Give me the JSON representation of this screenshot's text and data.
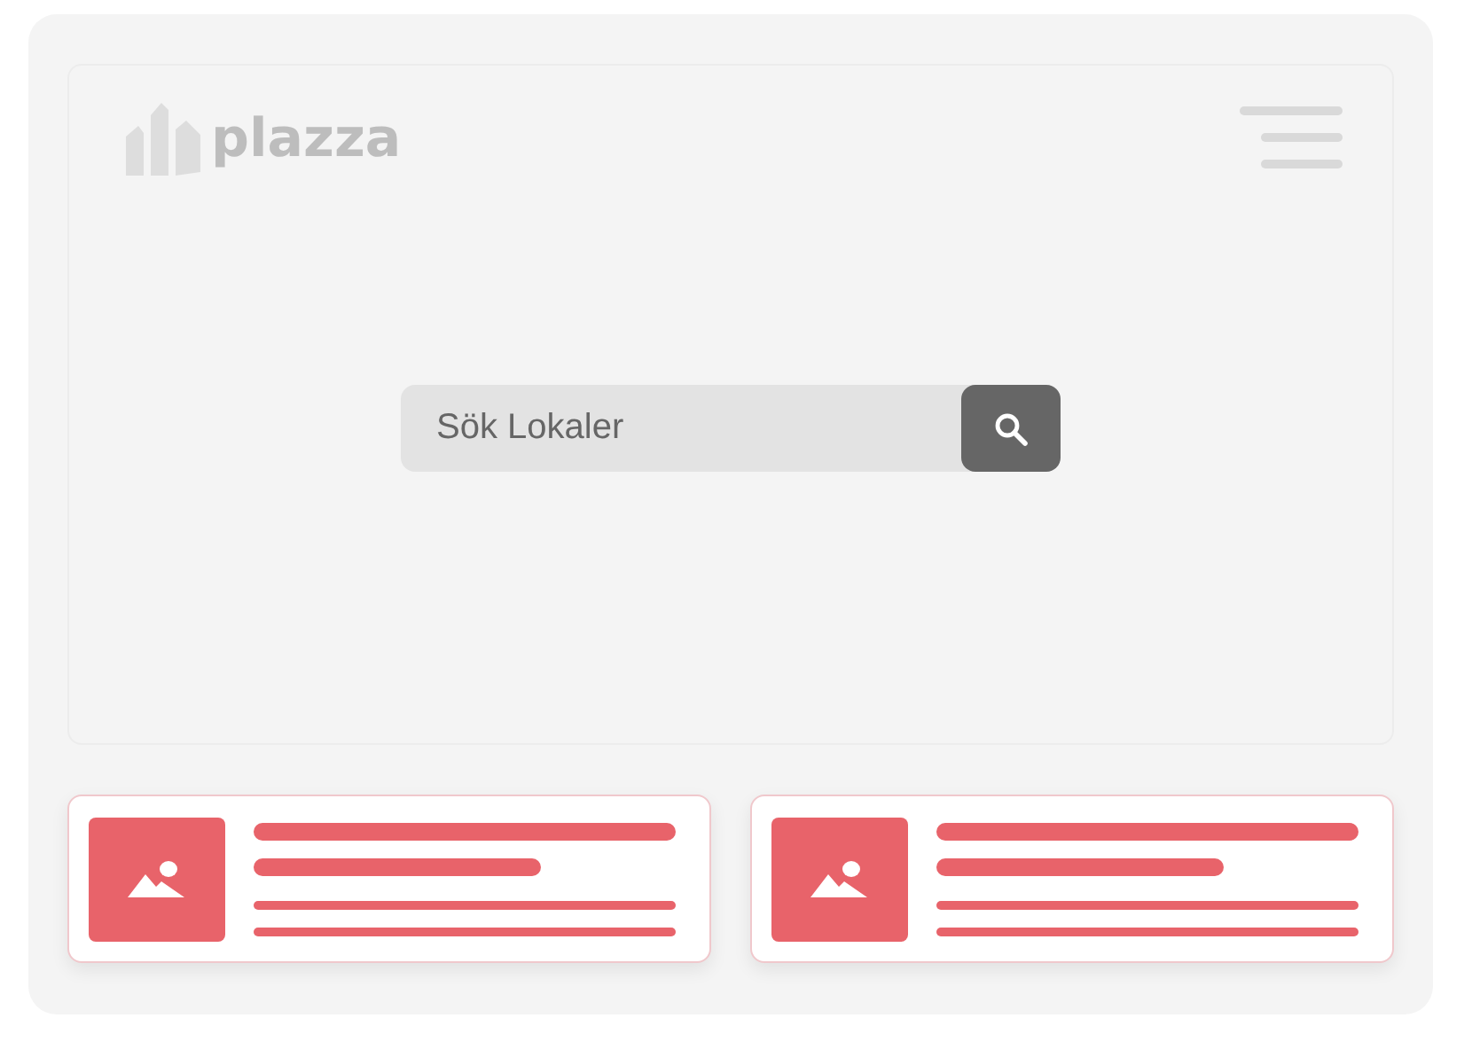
{
  "header": {
    "logo": "plazza"
  },
  "search": {
    "placeholder": "Sök Lokaler"
  },
  "cards": [
    {
      "kind": "placeholder"
    },
    {
      "kind": "placeholder"
    }
  ]
}
